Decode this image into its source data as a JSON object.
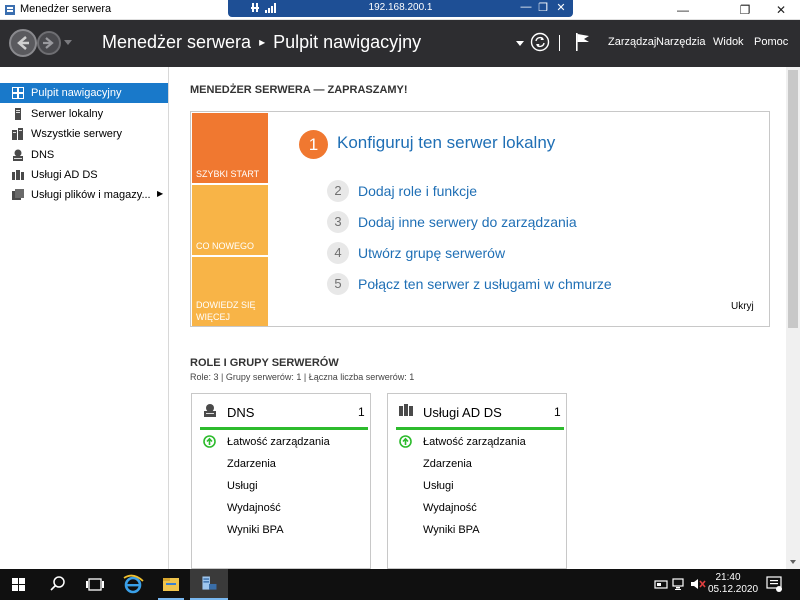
{
  "window": {
    "title": "Menedżer serwera",
    "min_glyph": "—",
    "max_glyph": "❐",
    "close_glyph": "✕"
  },
  "remote_bar": {
    "address": "192.168.200.1",
    "min_glyph": "—",
    "restore_glyph": "❐",
    "close_glyph": "✕"
  },
  "header": {
    "app_name": "Menedżer serwera",
    "separator": "▸",
    "current_page": "Pulpit nawigacyjny",
    "menu": {
      "manage": "Zarządzaj",
      "tools": "Narzędzia",
      "view": "Widok",
      "help": "Pomoc"
    }
  },
  "sidebar": {
    "items": [
      {
        "label": "Pulpit nawigacyjny",
        "icon": "dashboard-icon",
        "active": true
      },
      {
        "label": "Serwer lokalny",
        "icon": "server-icon"
      },
      {
        "label": "Wszystkie serwery",
        "icon": "servers-icon"
      },
      {
        "label": "DNS",
        "icon": "dns-icon"
      },
      {
        "label": "Usługi AD DS",
        "icon": "ad-ds-icon"
      },
      {
        "label": "Usługi plików i magazy...",
        "icon": "file-storage-icon",
        "arrow": "▶"
      }
    ]
  },
  "welcome": {
    "title": "MENEDŻER SERWERA — ZAPRASZAMY!",
    "tabs": {
      "quick_start": "SZYBKI START",
      "whats_new": "CO NOWEGO",
      "learn_more_line1": "DOWIEDZ SIĘ",
      "learn_more_line2": "WIĘCEJ"
    },
    "steps": [
      {
        "num": "1",
        "label": "Konfiguruj ten serwer lokalny"
      },
      {
        "num": "2",
        "label": "Dodaj role i funkcje"
      },
      {
        "num": "3",
        "label": "Dodaj inne serwery do zarządzania"
      },
      {
        "num": "4",
        "label": "Utwórz grupę serwerów"
      },
      {
        "num": "5",
        "label": "Połącz ten serwer z usługami w chmurze"
      }
    ],
    "hide": "Ukryj"
  },
  "roles": {
    "title": "ROLE I GRUPY SERWERÓW",
    "summary": "Role: 3 | Grupy serwerów: 1 | Łączna liczba serwerów: 1",
    "cards": [
      {
        "title": "DNS",
        "count": "1",
        "rows": [
          "Łatwość zarządzania",
          "Zdarzenia",
          "Usługi",
          "Wydajność",
          "Wyniki BPA"
        ]
      },
      {
        "title": "Usługi AD DS",
        "count": "1",
        "rows": [
          "Łatwość zarządzania",
          "Zdarzenia",
          "Usługi",
          "Wydajność",
          "Wyniki BPA"
        ]
      }
    ]
  },
  "taskbar": {
    "time": "21:40",
    "date": "05.12.2020"
  },
  "colors": {
    "accent_orange": "#f07830",
    "tab_yellow": "#f8b447",
    "link_blue": "#1f6fb5",
    "active_blue": "#1979ca",
    "status_green": "#2dbb2d",
    "header_dark": "#2d2d30"
  }
}
